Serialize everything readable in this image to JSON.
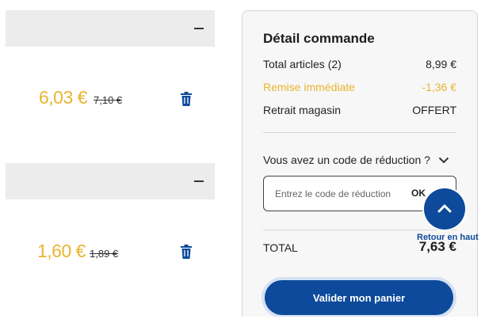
{
  "items": [
    {
      "price_current": "6,03 €",
      "price_old": "7,10 €"
    },
    {
      "price_current": "1,60 €",
      "price_old": "1,89 €"
    }
  ],
  "summary": {
    "title": "Détail commande",
    "total_items_label": "Total articles (2)",
    "total_items_value": "8,99 €",
    "discount_label": "Remise immédiate",
    "discount_value": "-1,36 €",
    "pickup_label": "Retrait magasin",
    "pickup_value": "OFFERT",
    "promo_question": "Vous avez un code de réduction ?",
    "promo_placeholder": "Entrez le code de réduction",
    "promo_ok": "OK",
    "total_label": "TOTAL",
    "total_value": "7,63 €",
    "validate_label": "Valider mon panier"
  },
  "back_to_top": {
    "label": "Retour en haut"
  },
  "icons": [
    "minus-icon",
    "trash-icon",
    "chevron-down-icon",
    "chevron-up-icon"
  ],
  "colors": {
    "accent": "#0d4a9b",
    "price": "#e8b530",
    "panel_bg": "#f7f7f7"
  }
}
